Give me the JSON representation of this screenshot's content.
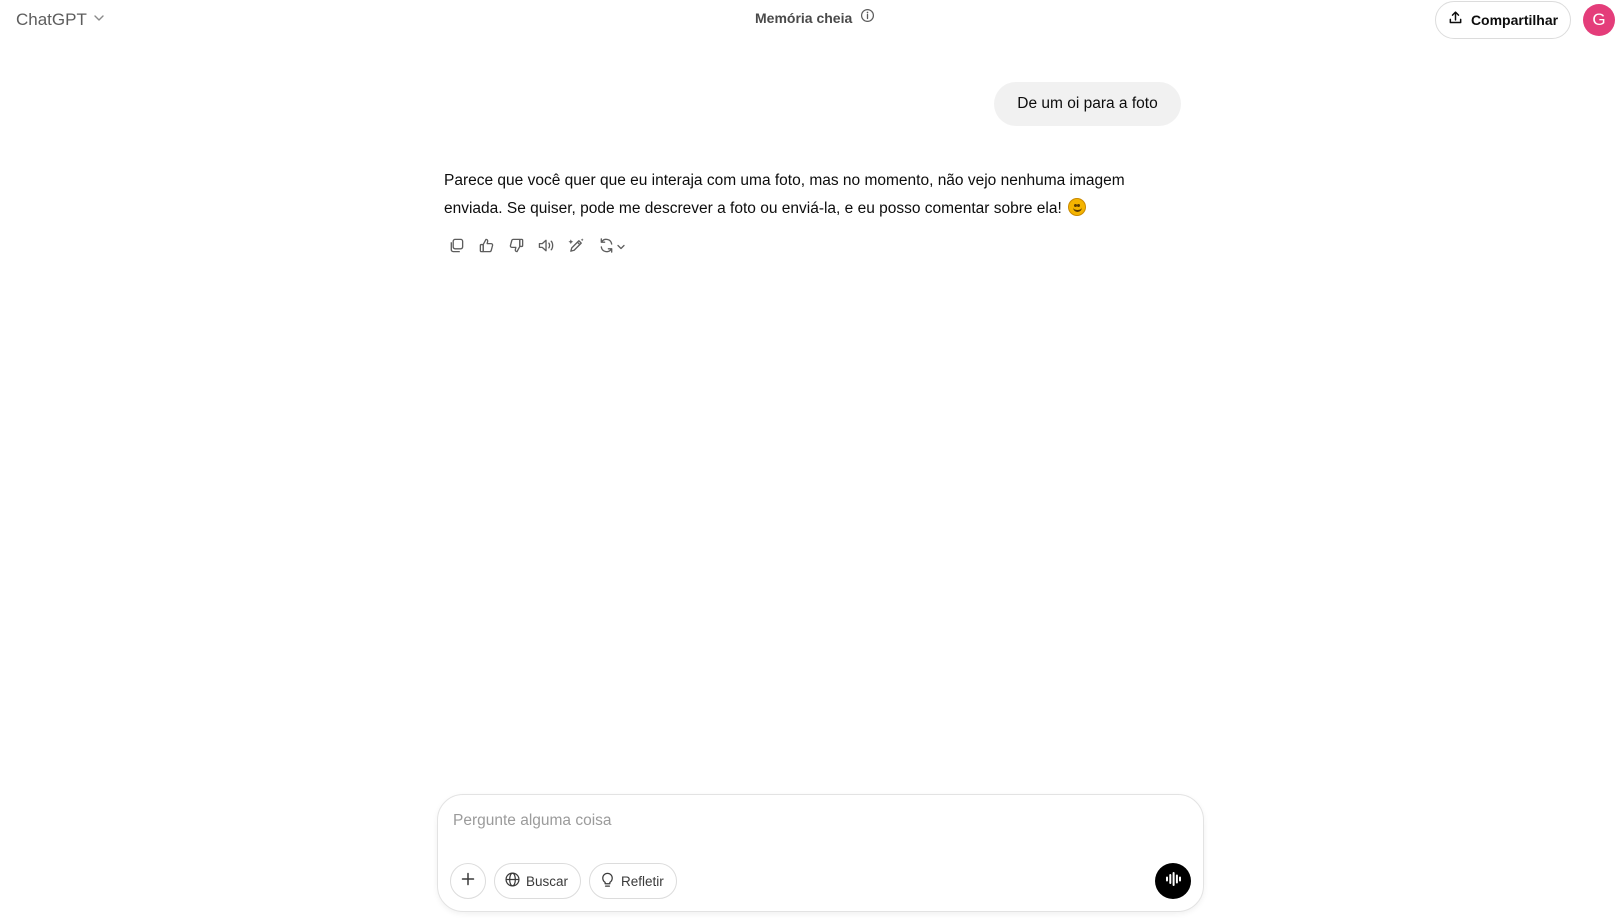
{
  "header": {
    "model_name": "ChatGPT",
    "memory_label": "Memória cheia",
    "share_label": "Compartilhar",
    "avatar_initial": "G",
    "avatar_color": "#e43d7a"
  },
  "conversation": {
    "user_message": "De um oi para a foto",
    "assistant_message": "Parece que você quer que eu interaja com uma foto, mas no momento, não vejo nenhuma imagem enviada. Se quiser, pode me descrever a foto ou enviá-la, e eu posso comentar sobre ela!",
    "assistant_emoji": "smiling-face-emoji",
    "actions": [
      "copy-icon",
      "thumbs-up-icon",
      "thumbs-down-icon",
      "read-aloud-icon",
      "edit-canvas-icon",
      "regenerate-icon"
    ]
  },
  "composer": {
    "placeholder": "Pergunte alguma coisa",
    "value": "",
    "search_label": "Buscar",
    "reason_label": "Refletir"
  }
}
